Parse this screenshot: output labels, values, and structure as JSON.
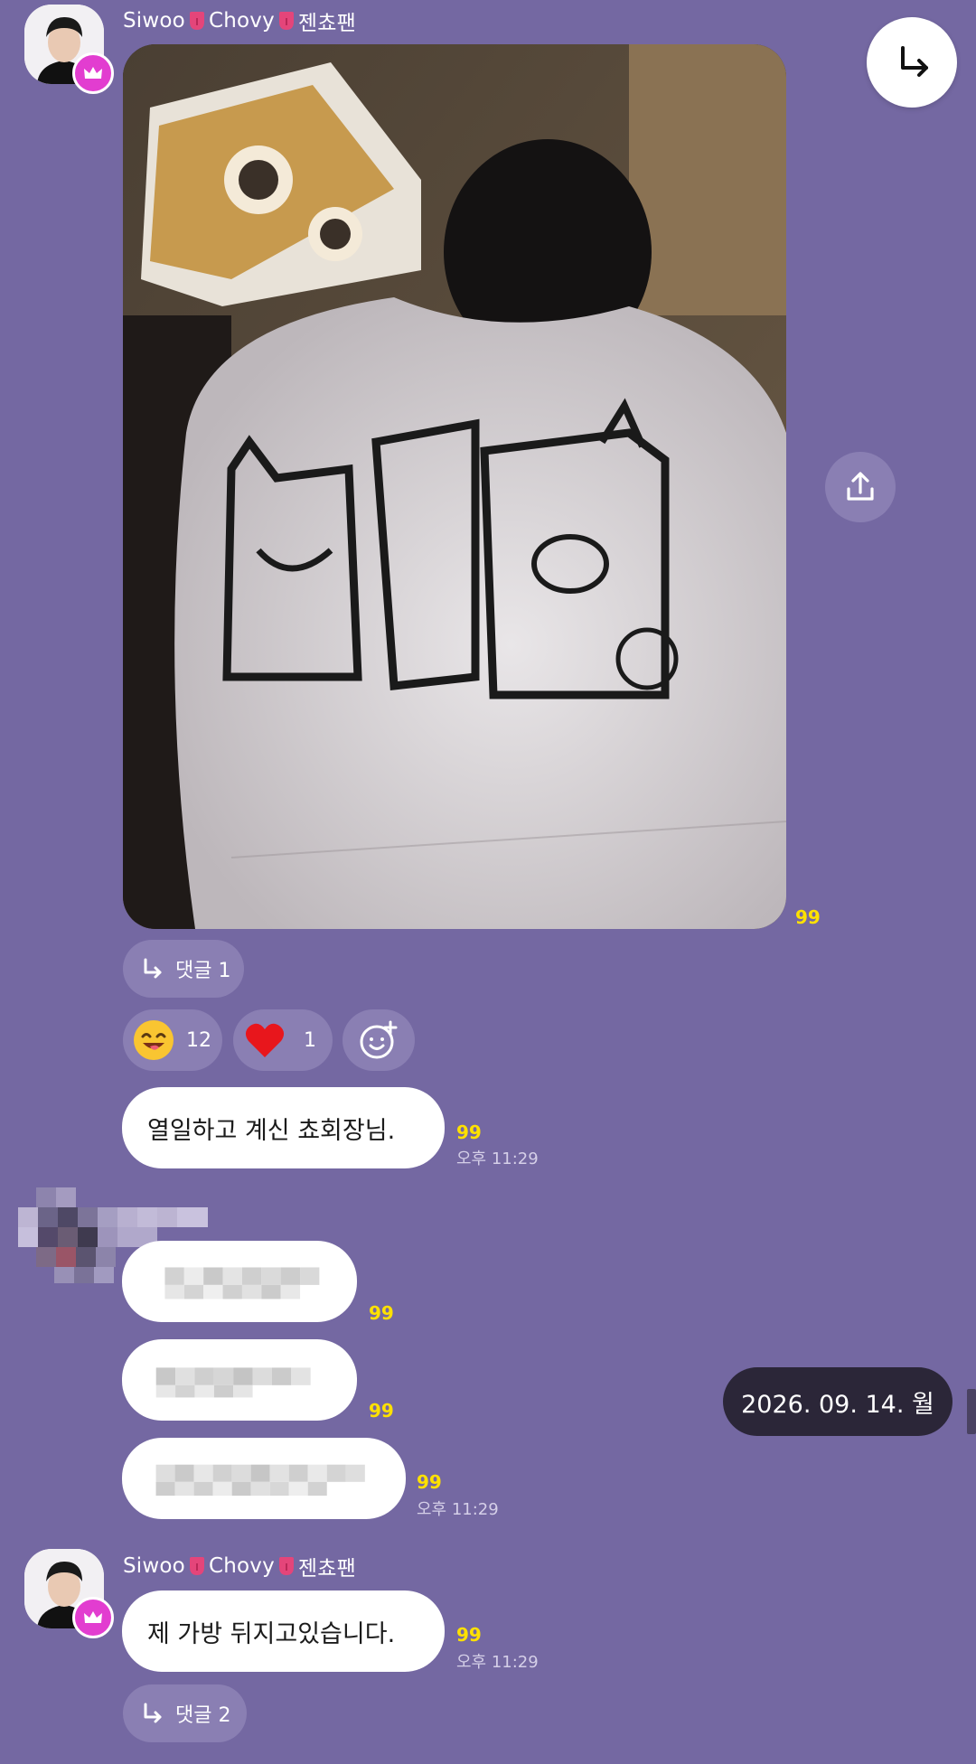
{
  "colors": {
    "background": "#7468a2",
    "bubble": "#ffffff",
    "unread": "#ffe100",
    "pill": "#8a7fb3",
    "date_pill": "#2b2638",
    "crown": "#e23dd0",
    "heart": "#e8161c"
  },
  "messages": {
    "first": {
      "sender": {
        "name_a": "Siwoo",
        "name_b": "Chovy",
        "name_c": "젠쵸팬"
      },
      "photo_unread": "99",
      "reply_label": "댓글 1",
      "reactions": [
        {
          "icon": "grin-emoji-icon",
          "count": "12"
        },
        {
          "icon": "heart-icon",
          "count": "1"
        }
      ],
      "text": "열일하고 계신 쵸회장님.",
      "text_unread": "99",
      "time": "오후 11:29"
    },
    "blurred": [
      {
        "unread": "99",
        "time": ""
      },
      {
        "unread": "99",
        "time": ""
      },
      {
        "unread": "99",
        "time": "오후 11:29"
      }
    ],
    "last": {
      "sender": {
        "name_a": "Siwoo",
        "name_b": "Chovy",
        "name_c": "젠쵸팬"
      },
      "text": "제 가방 뒤지고있습니다.",
      "unread": "99",
      "time": "오후 11:29",
      "reply_label": "댓글 2"
    }
  },
  "date_indicator": "2026. 09. 14. 월",
  "icons": [
    "forward-arrow-icon",
    "share-icon",
    "add-reaction-icon",
    "reply-arrow-icon",
    "crown-icon"
  ]
}
